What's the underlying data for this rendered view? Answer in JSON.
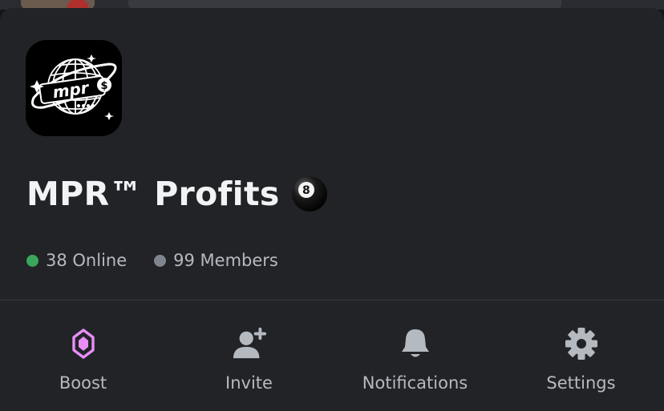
{
  "server": {
    "name": "MPR™ Profits",
    "emoji_icon": "8-ball-icon",
    "logo_icon": "mpr-globe-logo",
    "logo_text": "mpr$",
    "online": "38 Online",
    "members": "99 Members"
  },
  "colors": {
    "online_dot": "#3ba55d",
    "members_dot": "#80848e",
    "boost_accent": "#e88ef7",
    "muted_text": "#b5bac1",
    "sheet_bg": "#222327"
  },
  "actions": [
    {
      "label": "Boost",
      "icon": "boost-gem-icon"
    },
    {
      "label": "Invite",
      "icon": "add-user-icon"
    },
    {
      "label": "Notifications",
      "icon": "bell-icon"
    },
    {
      "label": "Settings",
      "icon": "gear-icon"
    }
  ]
}
